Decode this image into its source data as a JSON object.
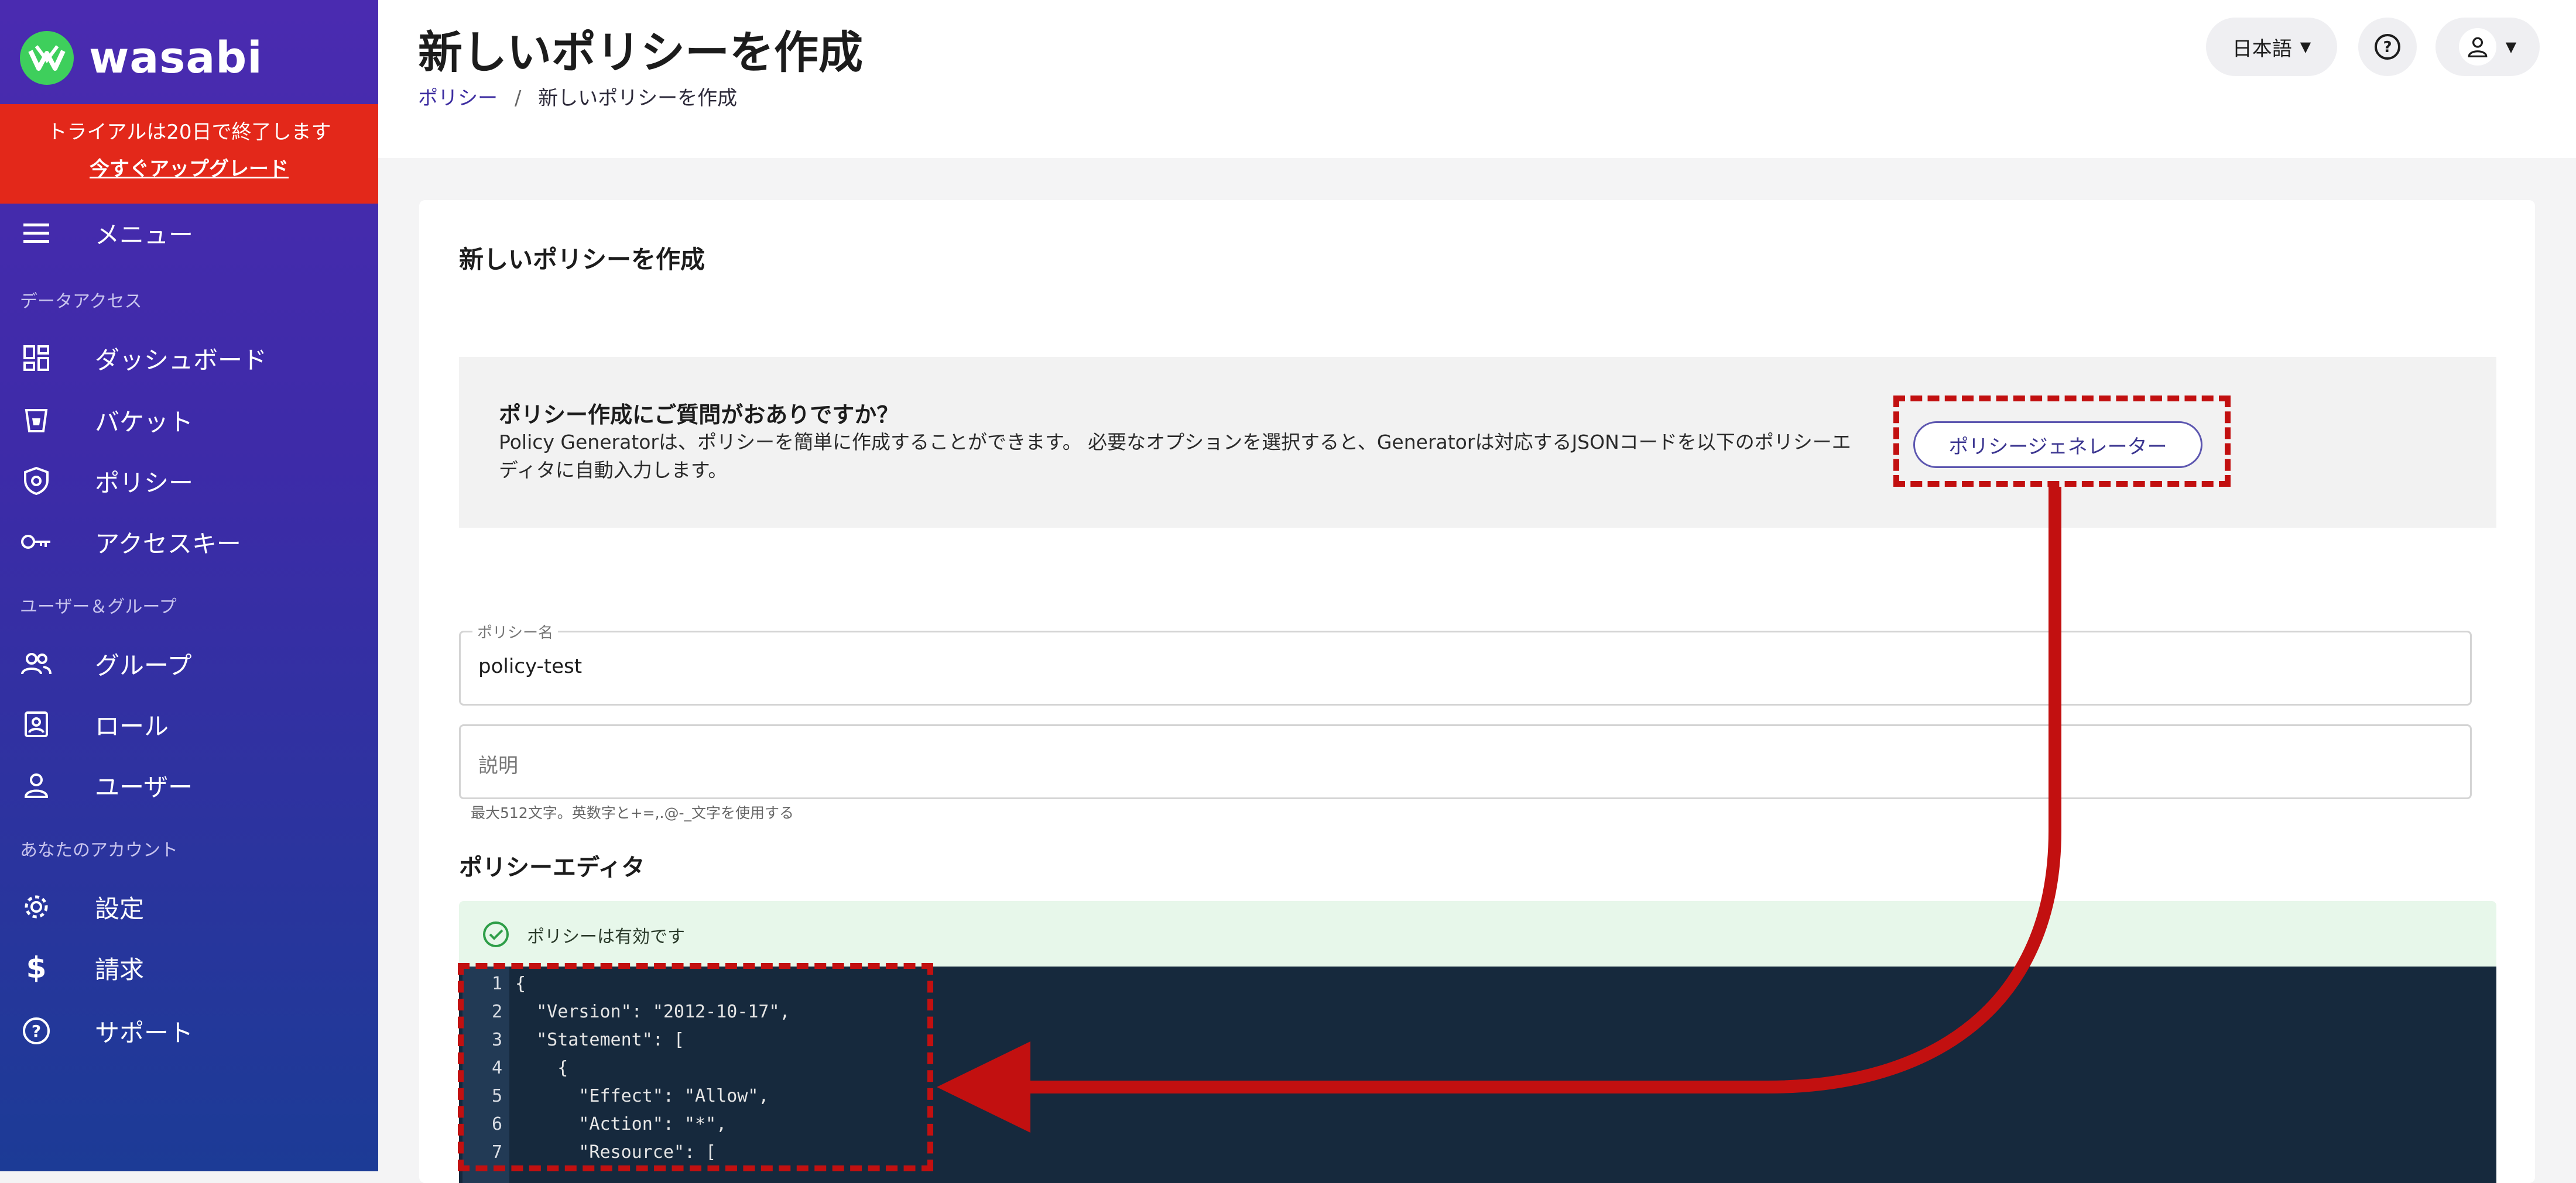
{
  "brand": {
    "name": "wasabi"
  },
  "trial": {
    "notice": "トライアルは20日で終了します",
    "upgrade": "今すぐアップグレード"
  },
  "sidebar": {
    "menu": "メニュー",
    "sections": [
      "データアクセス",
      "ユーザー＆グループ",
      "あなたのアカウント"
    ],
    "items": [
      {
        "label": "ダッシュボード",
        "icon": "dashboard-icon"
      },
      {
        "label": "バケット",
        "icon": "bucket-icon"
      },
      {
        "label": "ポリシー",
        "icon": "shield-icon"
      },
      {
        "label": "アクセスキー",
        "icon": "key-icon"
      },
      {
        "label": "グループ",
        "icon": "group-icon"
      },
      {
        "label": "ロール",
        "icon": "role-icon"
      },
      {
        "label": "ユーザー",
        "icon": "user-icon"
      },
      {
        "label": "設定",
        "icon": "gear-icon"
      },
      {
        "label": "請求",
        "icon": "dollar-icon"
      },
      {
        "label": "サポート",
        "icon": "help-icon"
      }
    ]
  },
  "header": {
    "title": "新しいポリシーを作成",
    "breadcrumb": {
      "parent": "ポリシー",
      "separator": "/",
      "current": "新しいポリシーを作成"
    },
    "language": "日本語"
  },
  "card": {
    "title": "新しいポリシーを作成",
    "help_title": "ポリシー作成にご質問がおありですか？",
    "help_text": "Policy Generatorは、ポリシーを簡単に作成することができます。 必要なオプションを選択すると、Generatorは対応するJSONコードを以下のポリシーエディタに自動入力します。",
    "generator_button": "ポリシージェネレーター",
    "policy_name_label": "ポリシー名",
    "policy_name_value": "policy-test",
    "description_placeholder": "説明",
    "description_hint": "最大512文字。英数字と+=,.@-_文字を使用する",
    "editor_title": "ポリシーエディタ",
    "valid_message": "ポリシーは有効です"
  },
  "editor": {
    "line_numbers": [
      "1",
      "2",
      "3",
      "4",
      "5",
      "6",
      "7"
    ],
    "lines": [
      "{",
      "  \"Version\": \"2012-10-17\",",
      "  \"Statement\": [",
      "    {",
      "      \"Effect\": \"Allow\",",
      "      \"Action\": \"*\",",
      "      \"Resource\": ["
    ]
  },
  "colors": {
    "sidebar_top": "#4a2bb0",
    "sidebar_bottom": "#1c3b96",
    "trial_bg": "#e3281a",
    "annotation": "#c21010",
    "editor_bg": "#16293d"
  }
}
